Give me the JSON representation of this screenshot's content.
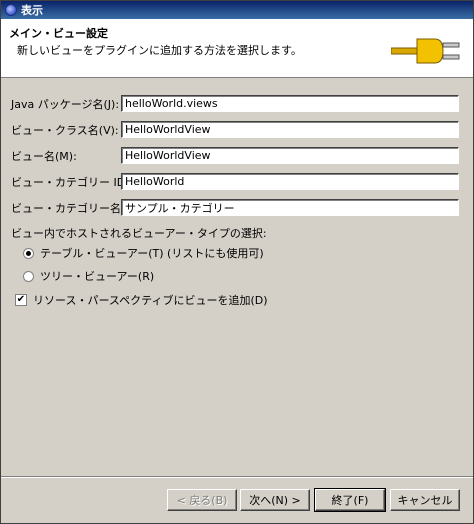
{
  "window": {
    "title": "表示"
  },
  "banner": {
    "title": "メイン・ビュー設定",
    "description": "新しいビューをプラグインに追加する方法を選択します。",
    "icon": "plug-icon"
  },
  "form": {
    "package": {
      "label": "Java パッケージ名(J):",
      "value": "helloWorld.views"
    },
    "class_name": {
      "label": "ビュー・クラス名(V):",
      "value": "HelloWorldView"
    },
    "view_name": {
      "label": "ビュー名(M):",
      "value": "HelloWorldView"
    },
    "category_id": {
      "label": "ビュー・カテゴリー ID(C):",
      "value": "HelloWorld"
    },
    "category_name": {
      "label": "ビュー・カテゴリー名(I):",
      "value": "サンプル・カテゴリー"
    }
  },
  "viewer": {
    "group_label": "ビュー内でホストされるビューアー・タイプの選択:",
    "options": [
      {
        "label": "テーブル・ビューアー(T) (リストにも使用可)",
        "selected": true
      },
      {
        "label": "ツリー・ビューアー(R)",
        "selected": false
      }
    ]
  },
  "perspective": {
    "label": "リソース・パースペクティブにビューを追加(D)",
    "checked": true,
    "mark": "✔"
  },
  "buttons": {
    "back": "< 戻る(B)",
    "next": "次へ(N) >",
    "finish": "終了(F)",
    "cancel": "キャンセル"
  }
}
